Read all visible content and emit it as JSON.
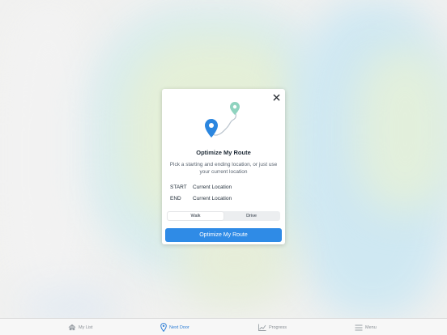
{
  "modal": {
    "title": "Optimize My Route",
    "description": "Pick a starting and ending location, or just use your current location",
    "start": {
      "label": "START",
      "value": "Current Location"
    },
    "end": {
      "label": "END",
      "value": "Current Location"
    },
    "modes": [
      "Walk",
      "Drive"
    ],
    "selected_mode": "Walk",
    "primary_button": "Optimize My Route",
    "close_icon": "close-icon",
    "illustration_icons": [
      "blue-map-pin",
      "teal-map-pin",
      "route-path"
    ]
  },
  "tabbar": {
    "items": [
      {
        "label": "My List",
        "icon": "home-icon",
        "active": false
      },
      {
        "label": "Next Door",
        "icon": "location-pin-icon",
        "active": true
      },
      {
        "label": "Progress",
        "icon": "chart-icon",
        "active": false
      },
      {
        "label": "Menu",
        "icon": "menu-icon",
        "active": false
      }
    ]
  },
  "colors": {
    "accent": "#2f8be6",
    "active_tab": "#2f7fd6",
    "pin_blue": "#2b86df",
    "pin_teal": "#8fd3bf"
  }
}
